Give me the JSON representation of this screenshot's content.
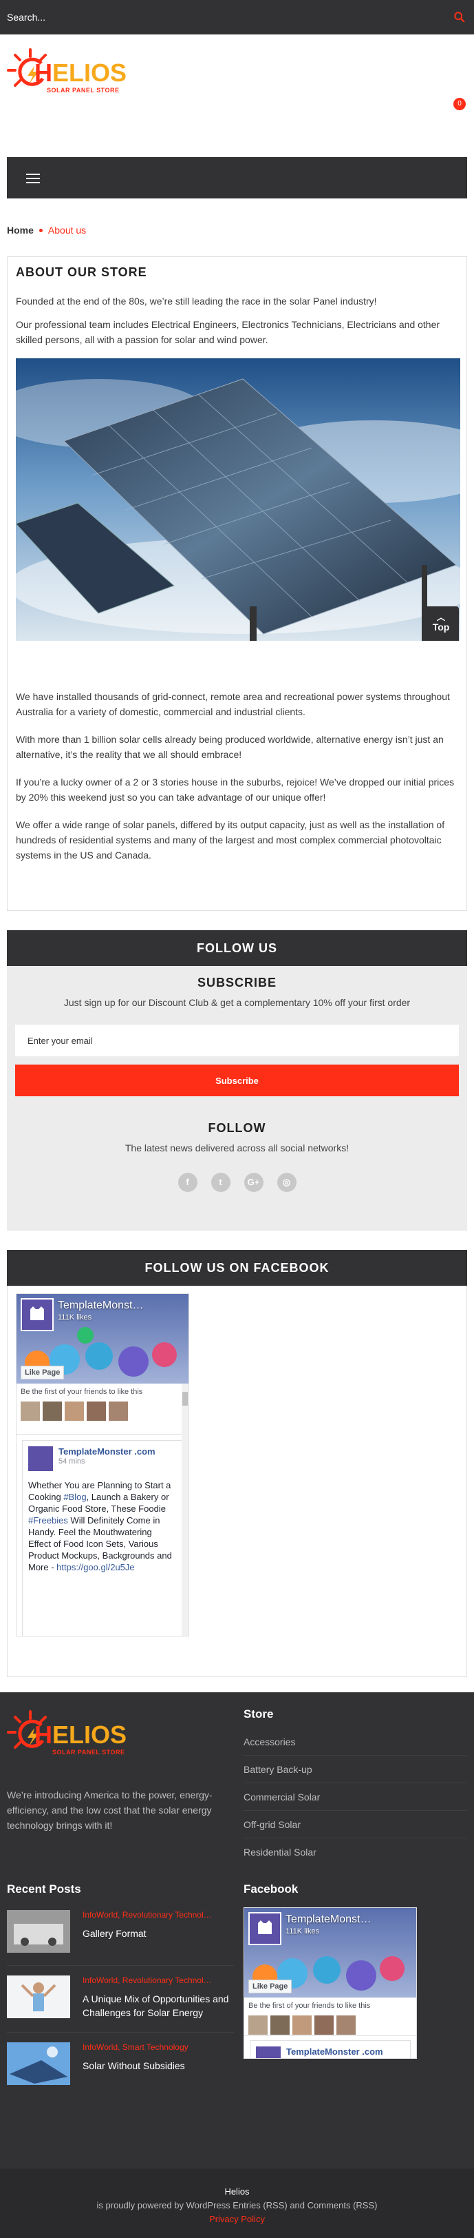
{
  "search": {
    "placeholder": "Search..."
  },
  "cart": {
    "count": "0"
  },
  "brand": {
    "name": "HELIOS",
    "tagline": "SOLAR PANEL STORE",
    "accent": "#ff2e17"
  },
  "breadcrumb": {
    "home": "Home",
    "current": "About us"
  },
  "about": {
    "title": "ABOUT OUR STORE",
    "p1": "Founded at the end of the 80s, we’re still leading the race in the solar Panel industry!",
    "p2": "Our professional team includes Electrical Engineers, Electronics Technicians, Electricians and other skilled persons, all with a passion for solar and wind power.",
    "p3": "We have installed thousands of grid-connect, remote area and recreational power systems throughout Australia for a variety of domestic, commercial and industrial clients.",
    "p4": "With more than 1 billion solar cells already being produced worldwide, alternative energy isn’t just an alternative, it’s the reality that we all should embrace!",
    "p5": "If you’re a lucky owner of a 2 or 3 stories house in the suburbs, rejoice! We’ve dropped our initial prices by 20% this weekend just so you can take advantage of our unique offer!",
    "p6": "We offer a wide range of solar panels, differed by its output capacity, just as well as the installation of hundreds of residential systems and many of the largest and most complex commercial photovoltaic systems in the US and Canada.",
    "top_label": "Top"
  },
  "follow_us": {
    "title": "FOLLOW US",
    "subscribe_heading": "SUBSCRIBE",
    "subscribe_text": "Just sign up for our Discount Club & get a complementary 10% off your first order",
    "email_placeholder": "Enter your email",
    "subscribe_button": "Subscribe",
    "follow_heading": "FOLLOW",
    "follow_text": "The latest news delivered across all social networks!",
    "socials": [
      "f",
      "t",
      "G+",
      "◎"
    ]
  },
  "facebook": {
    "title": "FOLLOW US ON FACEBOOK",
    "page_name": "TemplateMonst…",
    "likes": "111K likes",
    "like_button": "Like Page",
    "friends_text": "Be the first of your friends to like this",
    "post_author": "TemplateMonster .com",
    "post_time": "54 mins",
    "post_text_1": "Whether You are Planning to Start a Cooking ",
    "post_link_1": "#Blog",
    "post_text_2": ", Launch a Bakery or Organic Food Store, These Foodie ",
    "post_link_2": "#Freebies",
    "post_text_3": " Will Definitely Come in Handy. Feel the Mouthwatering Effect of Food Icon Sets, Various Product Mockups, Backgrounds and More - ",
    "post_link_3": "https://goo.gl/2u5Je"
  },
  "footer": {
    "description": "We’re introducing America to the power, energy-efficiency, and the low cost that the solar energy technology brings with it!",
    "store_heading": "Store",
    "store_links": [
      "Accessories",
      "Battery Back-up",
      "Commercial Solar",
      "Off-grid Solar",
      "Residential Solar"
    ],
    "recent_posts_heading": "Recent Posts",
    "posts": [
      {
        "category": "InfoWorld, Revolutionary Technol…",
        "title": "Gallery Format"
      },
      {
        "category": "InfoWorld, Revolutionary Technol…",
        "title": "A Unique Mix of Opportunities and Challenges for Solar Energy"
      },
      {
        "category": "InfoWorld, Smart Technology",
        "title": "Solar Without Subsidies"
      }
    ],
    "facebook_heading": "Facebook",
    "fb_page_name": "TemplateMonst…",
    "fb_likes": "111K likes",
    "fb_like_button": "Like Page",
    "fb_friends_text": "Be the first of your friends to like this",
    "fb_post_author": "TemplateMonster .com"
  },
  "bottom": {
    "site_name": "Helios",
    "powered": "is proudly powered by WordPress Entries (RSS) and Comments (RSS)",
    "privacy": "Privacy Policy"
  }
}
